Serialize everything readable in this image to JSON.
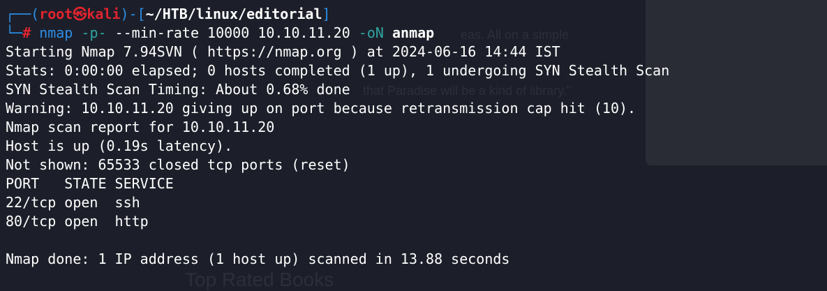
{
  "prompt": {
    "corner_top": "┌──(",
    "user": "root",
    "skull": "㉿",
    "host": "kali",
    "sep": ")-[",
    "path": "~/HTB/linux/editorial",
    "close": "]",
    "corner_bottom": "└─",
    "symbol": "#"
  },
  "command": {
    "program": "nmap",
    "flag1": "-p-",
    "flag2": "--min-rate",
    "rate": "10000",
    "target": "10.10.11.20",
    "flag3": "-oN",
    "outfile": "anmap"
  },
  "output": [
    "Starting Nmap 7.94SVN ( https://nmap.org ) at 2024-06-16 14:44 IST",
    "Stats: 0:00:00 elapsed; 0 hosts completed (1 up), 1 undergoing SYN Stealth Scan",
    "SYN Stealth Scan Timing: About 0.68% done",
    "Warning: 10.10.11.20 giving up on port because retransmission cap hit (10).",
    "Nmap scan report for 10.10.11.20",
    "Host is up (0.19s latency).",
    "Not shown: 65533 closed tcp ports (reset)",
    "PORT   STATE SERVICE",
    "22/tcp open  ssh",
    "80/tcp open  http",
    "",
    "Nmap done: 1 IP address (1 host up) scanned in 13.88 seconds"
  ],
  "background": {
    "ghost_a": "eas. All on a simple",
    "ghost_b": "that Paradise will be a kind of library.\"",
    "ghost_c": "Top Rated Books"
  },
  "colors": {
    "background": "#1c1f29",
    "prompt_blue": "#2b8ee8",
    "prompt_red": "#e0242f",
    "command_teal": "#2fa6a3",
    "text": "#ffffff"
  }
}
